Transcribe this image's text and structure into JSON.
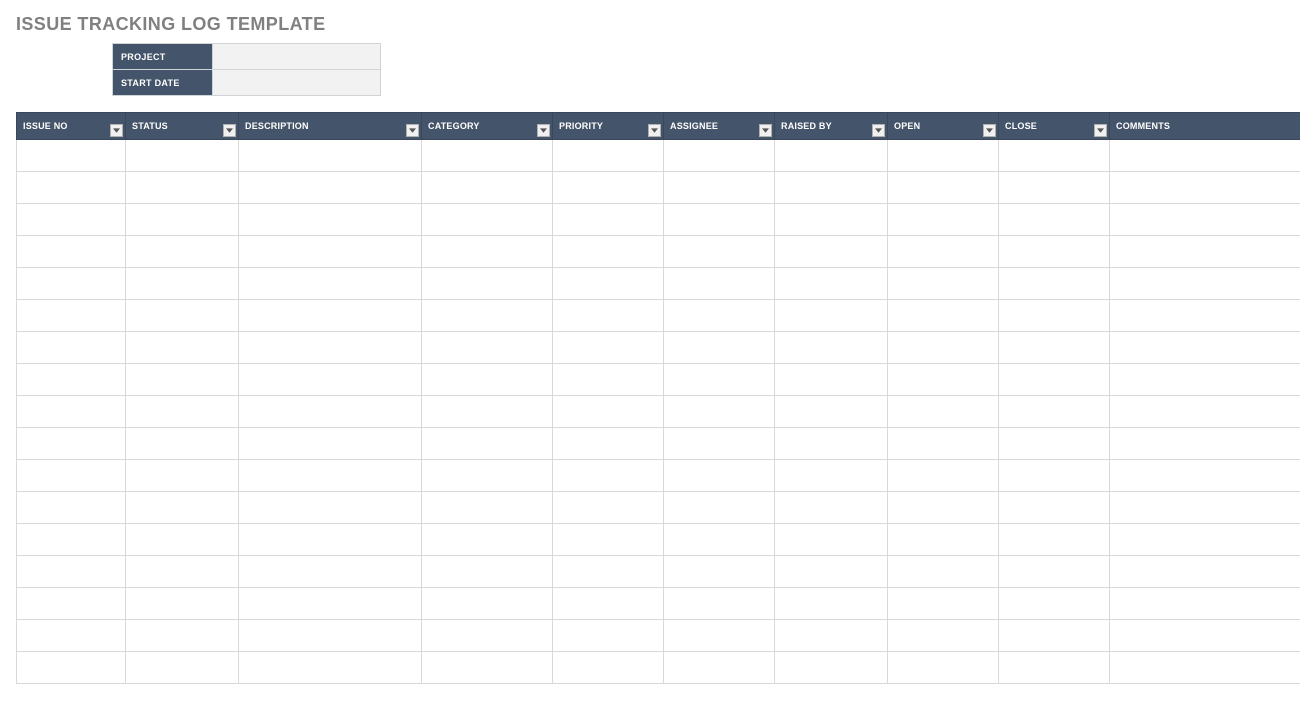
{
  "title": "ISSUE TRACKING LOG TEMPLATE",
  "meta": {
    "project_label": "PROJECT",
    "project_value": "",
    "start_date_label": "START DATE",
    "start_date_value": ""
  },
  "columns": [
    {
      "key": "issue_no",
      "label": "ISSUE NO",
      "class": "c-issue"
    },
    {
      "key": "status",
      "label": "STATUS",
      "class": "c-status"
    },
    {
      "key": "description",
      "label": "DESCRIPTION",
      "class": "c-desc"
    },
    {
      "key": "category",
      "label": "CATEGORY",
      "class": "c-category"
    },
    {
      "key": "priority",
      "label": "PRIORITY",
      "class": "c-priority"
    },
    {
      "key": "assignee",
      "label": "ASSIGNEE",
      "class": "c-assignee"
    },
    {
      "key": "raised_by",
      "label": "RAISED BY",
      "class": "c-raised"
    },
    {
      "key": "open",
      "label": "OPEN",
      "class": "c-open"
    },
    {
      "key": "close",
      "label": "CLOSE",
      "class": "c-close"
    },
    {
      "key": "comments",
      "label": "COMMENTS",
      "class": "c-comments"
    }
  ],
  "rows": [
    {},
    {},
    {},
    {},
    {},
    {},
    {},
    {},
    {},
    {},
    {},
    {},
    {},
    {},
    {},
    {},
    {}
  ],
  "colors": {
    "header_bg": "#44546a",
    "header_fg": "#ffffff",
    "grid_line": "#d9d9d9",
    "title_fg": "#808080"
  }
}
